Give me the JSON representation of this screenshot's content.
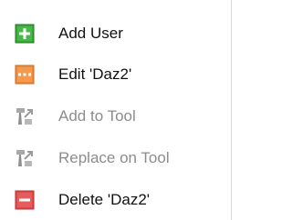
{
  "menu": {
    "items": [
      {
        "label": "Add User",
        "icon": "plus-icon",
        "enabled": true,
        "color": "#2ea52e"
      },
      {
        "label": "Edit 'Daz2'",
        "icon": "edit-icon",
        "enabled": true,
        "color": "#f08a3a"
      },
      {
        "label": "Add to Tool",
        "icon": "tool-icon",
        "enabled": false,
        "color": "#9a9a9a"
      },
      {
        "label": "Replace on Tool",
        "icon": "tool-replace-icon",
        "enabled": false,
        "color": "#9a9a9a"
      },
      {
        "label": "Delete 'Daz2'",
        "icon": "minus-icon",
        "enabled": true,
        "color": "#e04a4a"
      }
    ]
  }
}
